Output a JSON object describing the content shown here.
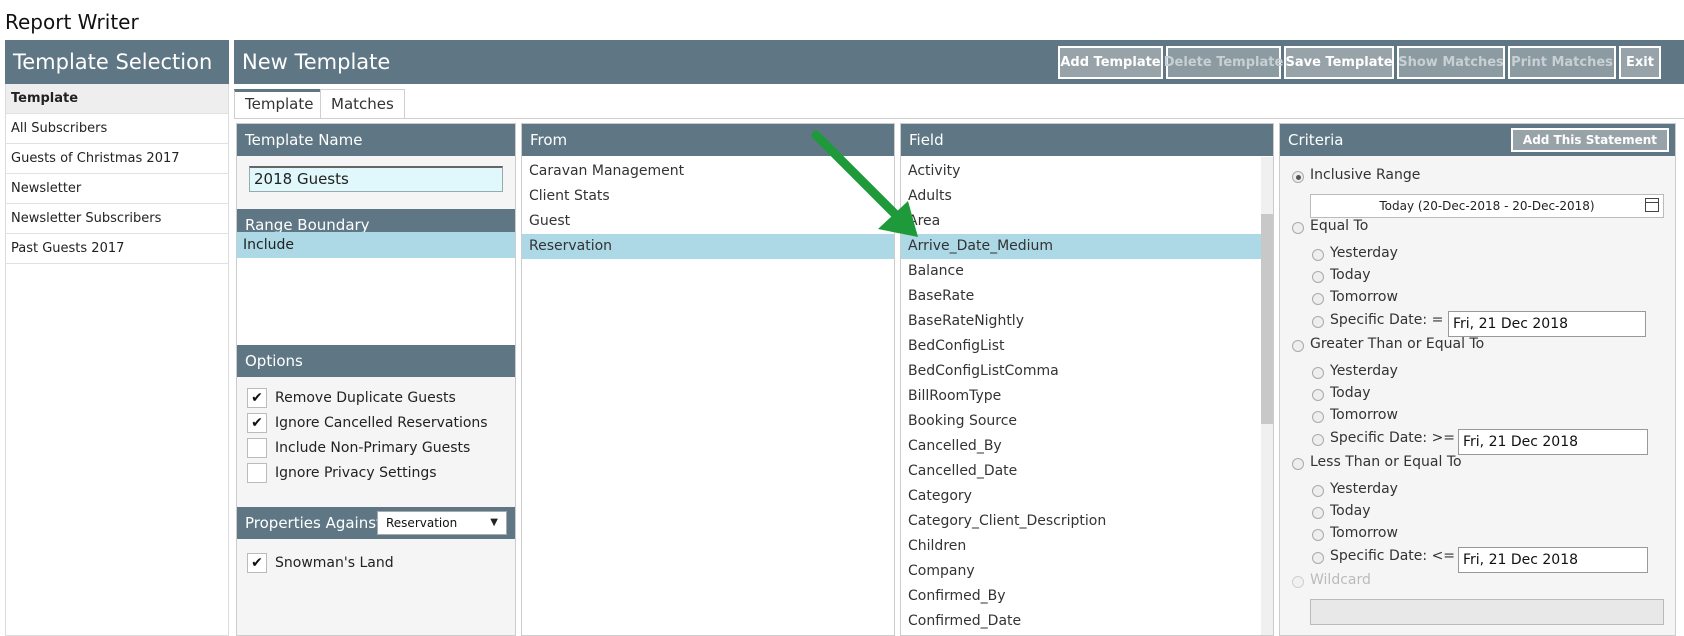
{
  "app": {
    "title": "Report Writer"
  },
  "template_selection": {
    "header": "Template Selection",
    "items": [
      {
        "label": "Template",
        "active": true
      },
      {
        "label": "All Subscribers"
      },
      {
        "label": "Guests of Christmas 2017"
      },
      {
        "label": "Newsletter"
      },
      {
        "label": "Newsletter Subscribers"
      },
      {
        "label": "Past Guests 2017"
      }
    ]
  },
  "toolbar": {
    "title": "New Template",
    "add_template": "Add Template",
    "delete_template": "Delete Template",
    "save_template": "Save Template",
    "show_matches": "Show Matches",
    "print_matches": "Print Matches",
    "exit": "Exit"
  },
  "tabs": {
    "template": "Template",
    "matches": "Matches"
  },
  "template_name": {
    "header": "Template Name",
    "value": "2018 Guests"
  },
  "range_boundary": {
    "header": "Range Boundary",
    "items": [
      "Include"
    ]
  },
  "options": {
    "header": "Options",
    "items": [
      {
        "label": "Remove Duplicate Guests",
        "checked": true
      },
      {
        "label": "Ignore Cancelled Reservations",
        "checked": true
      },
      {
        "label": "Include Non-Primary Guests",
        "checked": false
      },
      {
        "label": "Ignore Privacy Settings",
        "checked": false
      }
    ]
  },
  "properties_against": {
    "label": "Properties Against",
    "selected": "Reservation",
    "items": [
      {
        "label": "Snowman's Land",
        "checked": true
      }
    ]
  },
  "from": {
    "header": "From",
    "items": [
      "Caravan Management",
      "Client Stats",
      "Guest",
      "Reservation"
    ],
    "selected_index": 3
  },
  "field": {
    "header": "Field",
    "items": [
      "Activity",
      "Adults",
      "Area",
      "Arrive_Date_Medium",
      "Balance",
      "BaseRate",
      "BaseRateNightly",
      "BedConfigList",
      "BedConfigListComma",
      "BillRoomType",
      "Booking Source",
      "Cancelled_By",
      "Cancelled_Date",
      "Category",
      "Category_Client_Description",
      "Children",
      "Company",
      "Confirmed_By",
      "Confirmed_Date"
    ],
    "selected_index": 3
  },
  "criteria": {
    "header": "Criteria",
    "add_statement": "Add This Statement",
    "inclusive_range": "Inclusive Range",
    "range_value": "Today (20-Dec-2018 - 20-Dec-2018)",
    "equal_to": "Equal To",
    "greater_equal": "Greater Than or Equal To",
    "less_equal": "Less Than or Equal To",
    "wildcard": "Wildcard",
    "yesterday": "Yesterday",
    "today": "Today",
    "tomorrow": "Tomorrow",
    "specific_eq": "Specific Date: =",
    "specific_ge": "Specific Date: >=",
    "specific_le": "Specific Date: <=",
    "date_value": "Fri, 21 Dec 2018"
  },
  "colors": {
    "header_bg": "#5f7785",
    "selected_bg": "#add8e6",
    "arrow": "#1e9a3a"
  }
}
